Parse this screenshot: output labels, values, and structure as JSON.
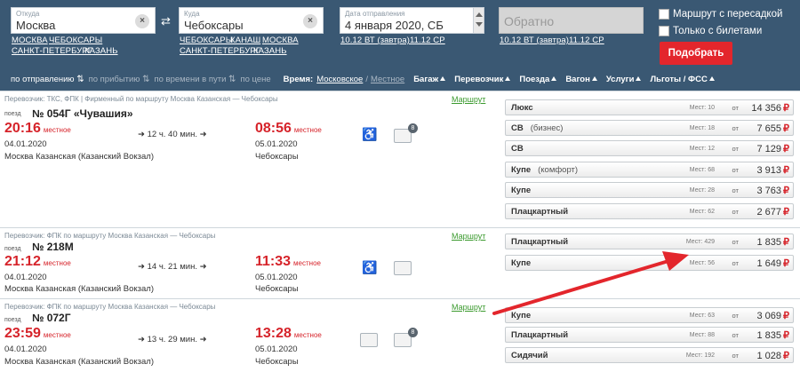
{
  "search": {
    "from": {
      "label": "Откуда",
      "value": "Москва"
    },
    "to": {
      "label": "Куда",
      "value": "Чебоксары"
    },
    "date": {
      "label": "Дата отправления",
      "value": "4 января 2020, СБ"
    },
    "return": {
      "placeholder": "Обратно"
    },
    "from_quick": [
      "МОСКВА",
      "ЧЕБОКСАРЫ",
      "САНКТ-ПЕТЕРБУРГ",
      "КАЗАНЬ"
    ],
    "to_quick": [
      "ЧЕБОКСАРЫ",
      "КАНАШ",
      "МОСКВА",
      "САНКТ-ПЕТЕРБУРГ",
      "КАЗАНЬ"
    ],
    "date_quick": [
      "10.12 ВТ (завтра)",
      "11.12 СР"
    ],
    "return_quick": [
      "10.12 ВТ (завтра)",
      "11.12 СР"
    ],
    "check_transfer": "Маршрут с пересадкой",
    "check_tickets": "Только с билетами",
    "find_button": "Подобрать"
  },
  "sortbar": {
    "by_departure": "по отправлению",
    "by_arrival": "по прибытию",
    "by_travel_time": "по времени в пути",
    "by_price": "по цене",
    "time_label": "Время:",
    "time_moscow": "Московское",
    "time_separator": "/",
    "time_local": "Местное",
    "filters": [
      "Багаж",
      "Перевозчик",
      "Поезда",
      "Вагон",
      "Услуги",
      "Льготы / ФСС"
    ]
  },
  "common": {
    "train_prefix": "поезд",
    "local": "местное",
    "route_link": "Маршрут",
    "seats_label": "Мест:",
    "from_label": "от",
    "currency": "₽"
  },
  "trains": [
    {
      "carrier": "Перевозчик: ТКС, ФПК | Фирменный    по маршруту Москва Казанская — Чебоксары",
      "number": "№ 054Г «Чувашия»",
      "dep_time": "20:16",
      "dep_date": "04.01.2020",
      "dep_station": "Москва Казанская (Казанский Вокзал)",
      "duration": "12 ч. 40 мин.",
      "arr_time": "08:56",
      "arr_date": "05.01.2020",
      "arr_station": "Чебоксары",
      "badge": "8",
      "classes": [
        {
          "name": "Люкс",
          "sub": "",
          "seats": "10",
          "price": "14 356"
        },
        {
          "name": "СВ",
          "sub": "(бизнес)",
          "seats": "18",
          "price": "7 655"
        },
        {
          "name": "СВ",
          "sub": "",
          "seats": "12",
          "price": "7 129"
        },
        {
          "name": "Купе",
          "sub": "(комфорт)",
          "seats": "68",
          "price": "3 913"
        },
        {
          "name": "Купе",
          "sub": "",
          "seats": "28",
          "price": "3 763"
        },
        {
          "name": "Плацкартный",
          "sub": "",
          "seats": "62",
          "price": "2 677"
        }
      ]
    },
    {
      "carrier": "Перевозчик: ФПК    по маршруту Москва Казанская — Чебоксары",
      "number": "№ 218М",
      "dep_time": "21:12",
      "dep_date": "04.01.2020",
      "dep_station": "Москва Казанская (Казанский Вокзал)",
      "duration": "14 ч. 21 мин.",
      "arr_time": "11:33",
      "arr_date": "05.01.2020",
      "arr_station": "Чебоксары",
      "badge": "",
      "classes": [
        {
          "name": "Плацкартный",
          "sub": "",
          "seats": "429",
          "price": "1 835"
        },
        {
          "name": "Купе",
          "sub": "",
          "seats": "56",
          "price": "1 649"
        }
      ]
    },
    {
      "carrier": "Перевозчик: ФПК    по маршруту Москва Казанская — Чебоксары",
      "number": "№ 072Г",
      "dep_time": "23:59",
      "dep_date": "04.01.2020",
      "dep_station": "Москва Казанская (Казанский Вокзал)",
      "duration": "13 ч. 29 мин.",
      "arr_time": "13:28",
      "arr_date": "05.01.2020",
      "arr_station": "Чебоксары",
      "badge": "8",
      "classes": [
        {
          "name": "Купе",
          "sub": "",
          "seats": "63",
          "price": "3 069"
        },
        {
          "name": "Плацкартный",
          "sub": "",
          "seats": "88",
          "price": "1 835"
        },
        {
          "name": "Сидячий",
          "sub": "",
          "seats": "192",
          "price": "1 028"
        }
      ]
    }
  ],
  "colors": {
    "header_bg": "#3a5873",
    "accent_red": "#d6232a",
    "button_red": "#e3262c",
    "link_green": "#3b9a2e"
  }
}
